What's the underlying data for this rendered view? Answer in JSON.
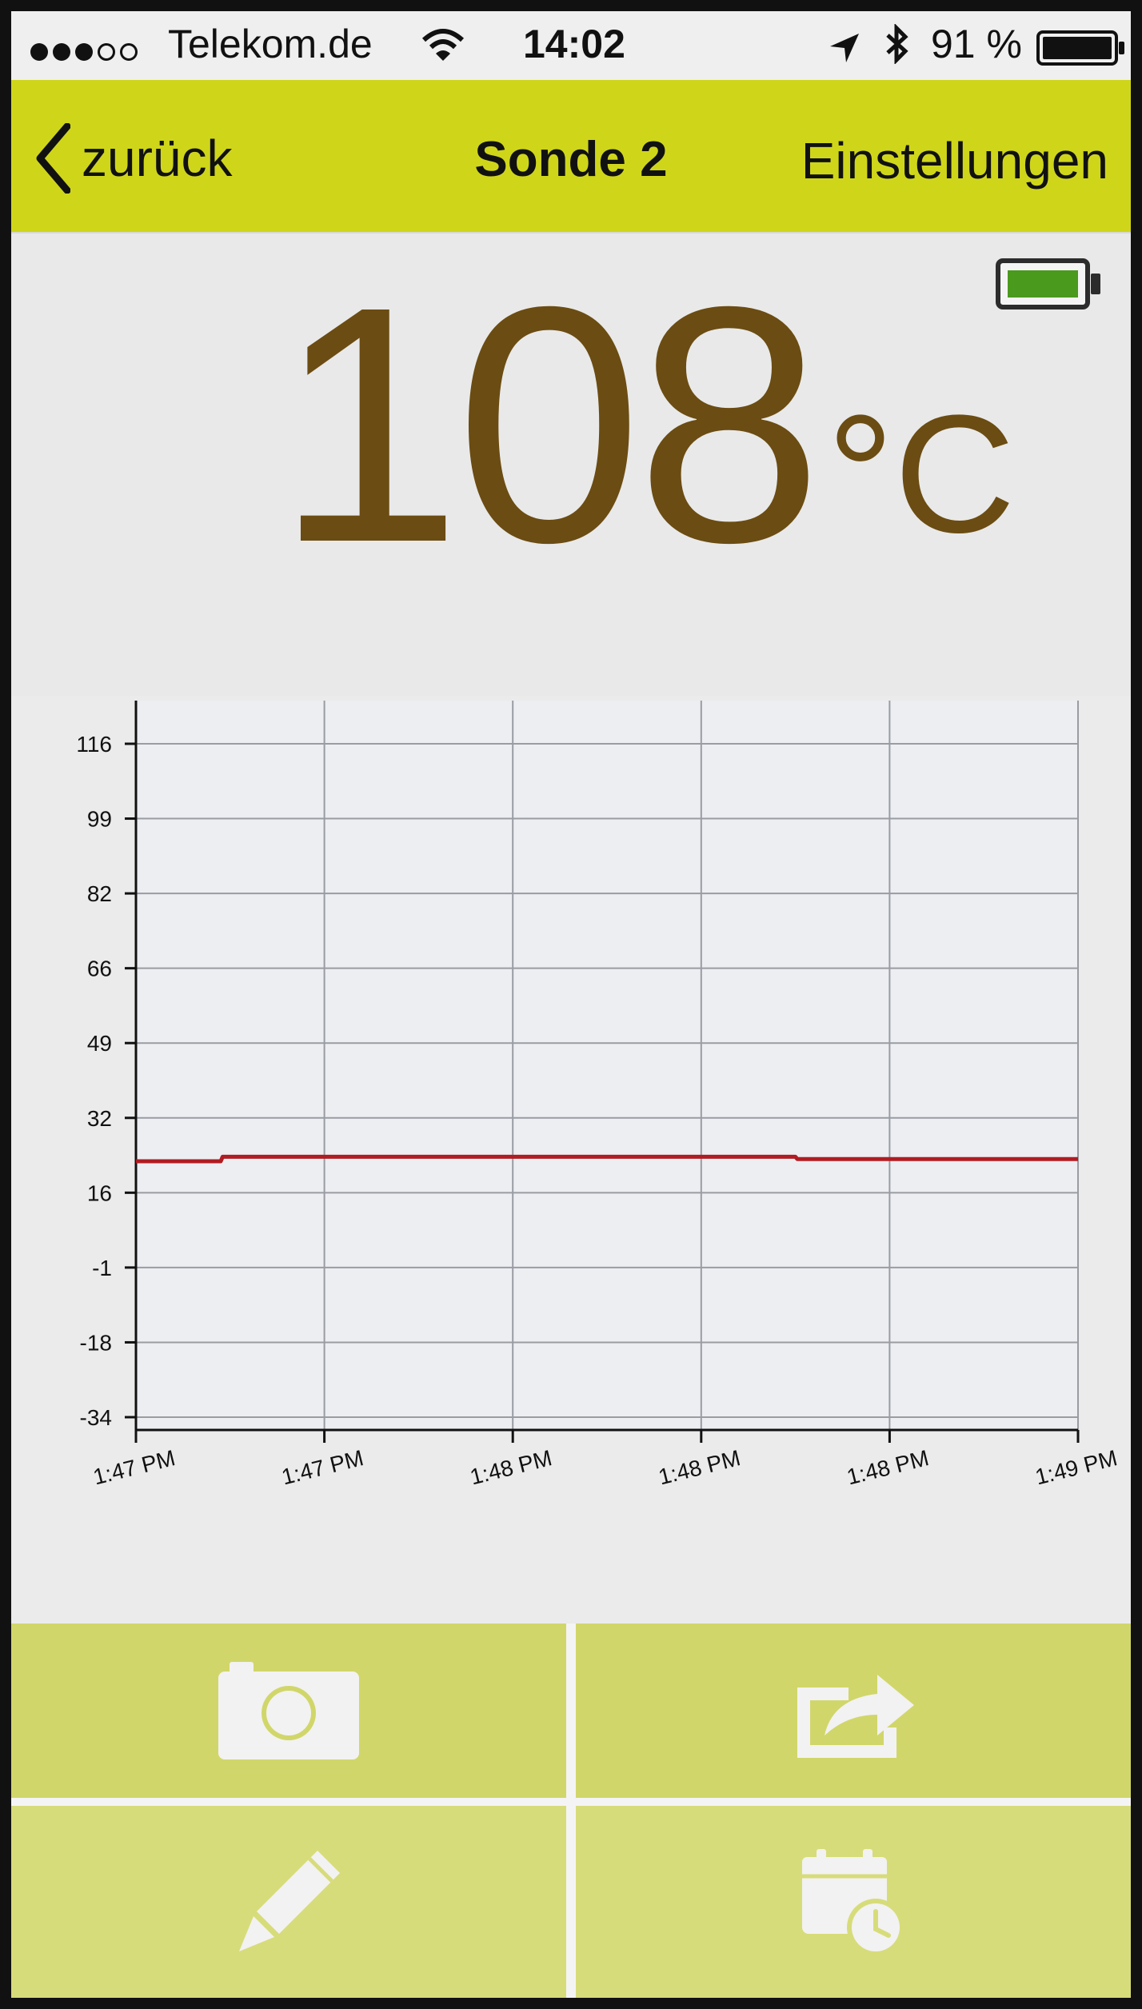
{
  "status_bar": {
    "carrier": "Telekom.de",
    "time": "14:02",
    "battery_percent": "91 %",
    "signal_bars_filled": 3,
    "signal_bars_total": 5
  },
  "nav": {
    "back_label": "zurück",
    "title": "Sonde 2",
    "settings_label": "Einstellungen"
  },
  "reading": {
    "value": "108",
    "unit": "°C"
  },
  "colors": {
    "nav_bar": "#cfd61a",
    "temperature_text": "#6b4c12",
    "chart_line": "#b01c22",
    "button_tile": "#d1d66a",
    "probe_battery": "#4a9a1e"
  },
  "chart_data": {
    "type": "line",
    "y_ticks": [
      "116",
      "99",
      "82",
      "66",
      "49",
      "32",
      "16",
      "-1",
      "-18",
      "-34"
    ],
    "ylim": [
      -34,
      116
    ],
    "x_tick_labels": [
      "1:47 PM",
      "1:47 PM",
      "1:48 PM",
      "1:48 PM",
      "1:48 PM",
      "1:49 PM"
    ],
    "x": [
      0,
      0.45,
      0.46,
      3.5,
      3.51,
      5
    ],
    "series": [
      {
        "values": [
          23,
          23,
          24,
          24,
          23.5,
          23.5
        ]
      }
    ],
    "grid": true
  },
  "buttons": {
    "camera": "camera-icon",
    "share": "share-icon",
    "edit": "pencil-icon",
    "history": "calendar-clock-icon"
  }
}
